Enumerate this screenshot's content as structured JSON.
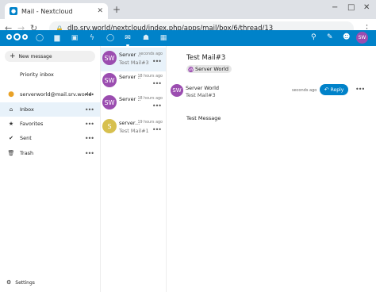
{
  "browser": {
    "tab_title": "Mail - Nextcloud",
    "url": "dlp.srv.world/nextcloud/index.php/apps/mail/box/6/thread/13"
  },
  "colors": {
    "brand": "#0082c9",
    "avatar_purple": "#9b4db0",
    "avatar_yellow": "#d7c04f",
    "selected_bg": "#e8f2fa"
  },
  "header": {
    "app_icons": [
      "dashboard-icon",
      "files-icon",
      "photos-icon",
      "activity-icon",
      "search-icon",
      "mail-icon",
      "contacts-icon",
      "calendar-icon"
    ],
    "active_app": "mail-icon",
    "avatar_initials": "SW"
  },
  "sidebar": {
    "new_message": "New message",
    "items": [
      {
        "label": "Priority inbox",
        "icon": "priority-icon"
      },
      {
        "label": "serverworld@mail.srv.world",
        "icon": "account-dot-icon"
      },
      {
        "label": "Inbox",
        "icon": "home-icon",
        "active": true
      },
      {
        "label": "Favorites",
        "icon": "star-icon"
      },
      {
        "label": "Sent",
        "icon": "sent-icon"
      },
      {
        "label": "Trash",
        "icon": "trash-icon"
      }
    ],
    "settings": "Settings"
  },
  "messages": [
    {
      "initials": "SW",
      "from": "Server ...",
      "time": "seconds ago",
      "subject": "Test Mail#3",
      "selected": true
    },
    {
      "initials": "SW",
      "from": "Server ...",
      "time": "18 hours ago",
      "subject": ""
    },
    {
      "initials": "SW",
      "from": "Server ...",
      "time": "18 hours ago",
      "subject": ""
    },
    {
      "initials": "S",
      "from": "server...",
      "time": "19 hours ago",
      "subject": "Test Mail#1"
    }
  ],
  "view": {
    "title": "Test Mail#3",
    "tag_label": "Server World",
    "tag_initials": "SW",
    "sender_initials": "SW",
    "sender_name": "Server World",
    "subject": "Test Mail#3",
    "time": "seconds ago",
    "reply_label": "Reply",
    "body": "Test Message"
  }
}
